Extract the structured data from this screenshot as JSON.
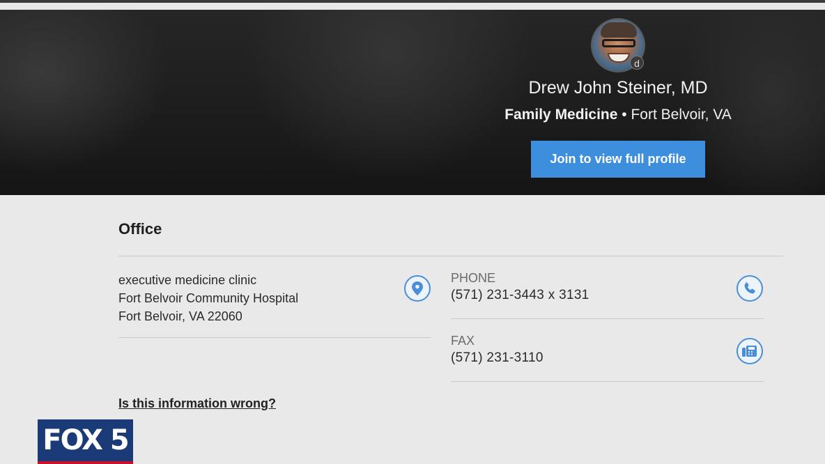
{
  "profile": {
    "name": "Drew John Steiner, MD",
    "specialty": "Family Medicine",
    "separator": "•",
    "location": "Fort Belvoir, VA",
    "avatar_badge": "d",
    "join_label": "Join to view full profile"
  },
  "office": {
    "title": "Office",
    "address_lines": [
      "executive medicine clinic",
      "Fort Belvoir Community Hospital",
      "Fort Belvoir, VA 22060"
    ],
    "phone_label": "PHONE",
    "phone_value": "(571) 231-3443 x 3131",
    "fax_label": "FAX",
    "fax_value": "(571) 231-3110",
    "wrong_info_link": "Is this information wrong?"
  },
  "icons": {
    "location": "map-pin-icon",
    "phone": "phone-icon",
    "fax": "fax-icon"
  },
  "watermark": {
    "text": "FOX 5"
  },
  "colors": {
    "accent": "#3d8fdd",
    "icon_ring": "#4a8fd6",
    "fox_blue": "#1b3a78",
    "fox_red": "#c8102e"
  }
}
